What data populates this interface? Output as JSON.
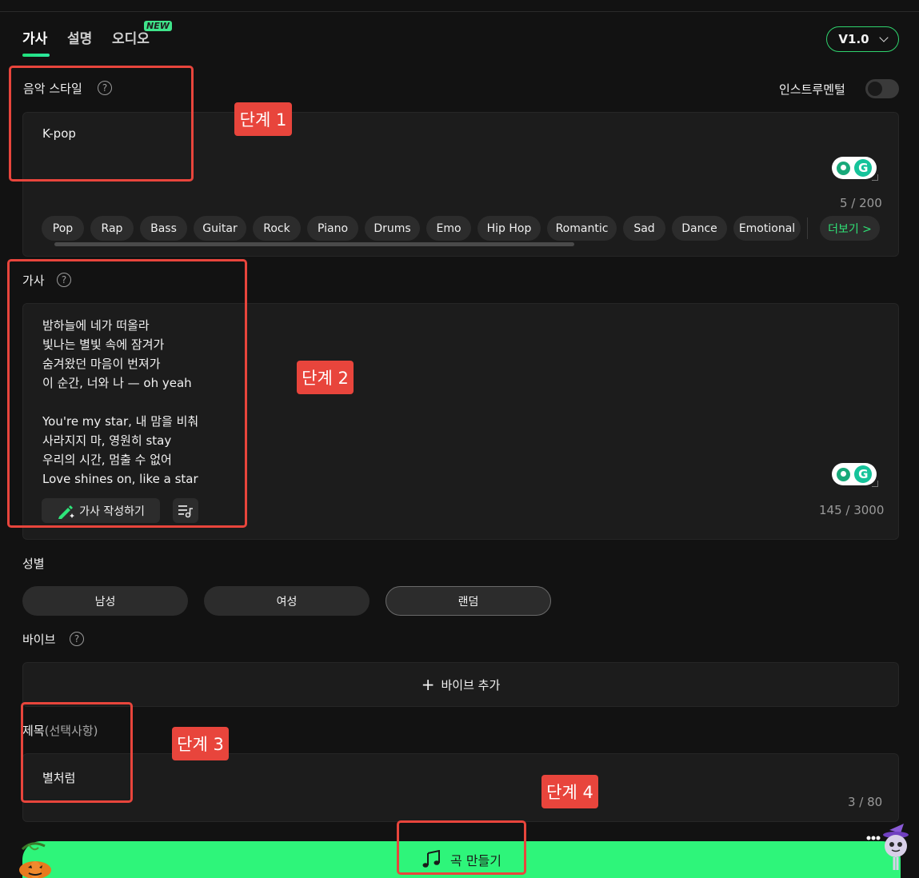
{
  "tabs": [
    {
      "label": "가사",
      "active": true
    },
    {
      "label": "설명",
      "active": false
    },
    {
      "label": "오디오",
      "active": false,
      "badge": "NEW"
    }
  ],
  "version": "V1.0",
  "style_section": {
    "label": "음악 스타일",
    "instrumental_label": "인스트루멘털",
    "instrumental_on": false,
    "value": "K-pop",
    "counter": "5 / 200",
    "tags": [
      "Pop",
      "Rap",
      "Bass",
      "Guitar",
      "Rock",
      "Piano",
      "Drums",
      "Emo",
      "Hip Hop",
      "Romantic",
      "Sad",
      "Dance",
      "Emotional"
    ],
    "more_label": "더보기 >"
  },
  "lyrics_section": {
    "label": "가사",
    "text": "밤하늘에 네가 떠올라\n빛나는 별빛 속에 잠겨가\n숨겨왔던 마음이 번져가\n이 순간, 너와 나 — oh yeah\n\nYou're my star, 내 맘을 비춰\n사라지지 마, 영원히 stay\n우리의 시간, 멈출 수 없어\nLove shines on, like a star",
    "write_button": "가사 작성하기",
    "counter": "145 / 3000"
  },
  "gender_section": {
    "label": "성별",
    "options": [
      "남성",
      "여성",
      "랜덤"
    ],
    "selected": "랜덤"
  },
  "vibe_section": {
    "label": "바이브",
    "add_label": "바이브 추가"
  },
  "title_section": {
    "label": "제목",
    "optional": "(선택사항)",
    "value": "별처럼",
    "counter": "3 / 80"
  },
  "create_button": "곡 만들기",
  "annotations": [
    "단계 1",
    "단계 2",
    "단계 3",
    "단계 4"
  ],
  "colors": {
    "accent": "#2ef57a",
    "annotation": "#e8453c",
    "background": "#121212"
  }
}
